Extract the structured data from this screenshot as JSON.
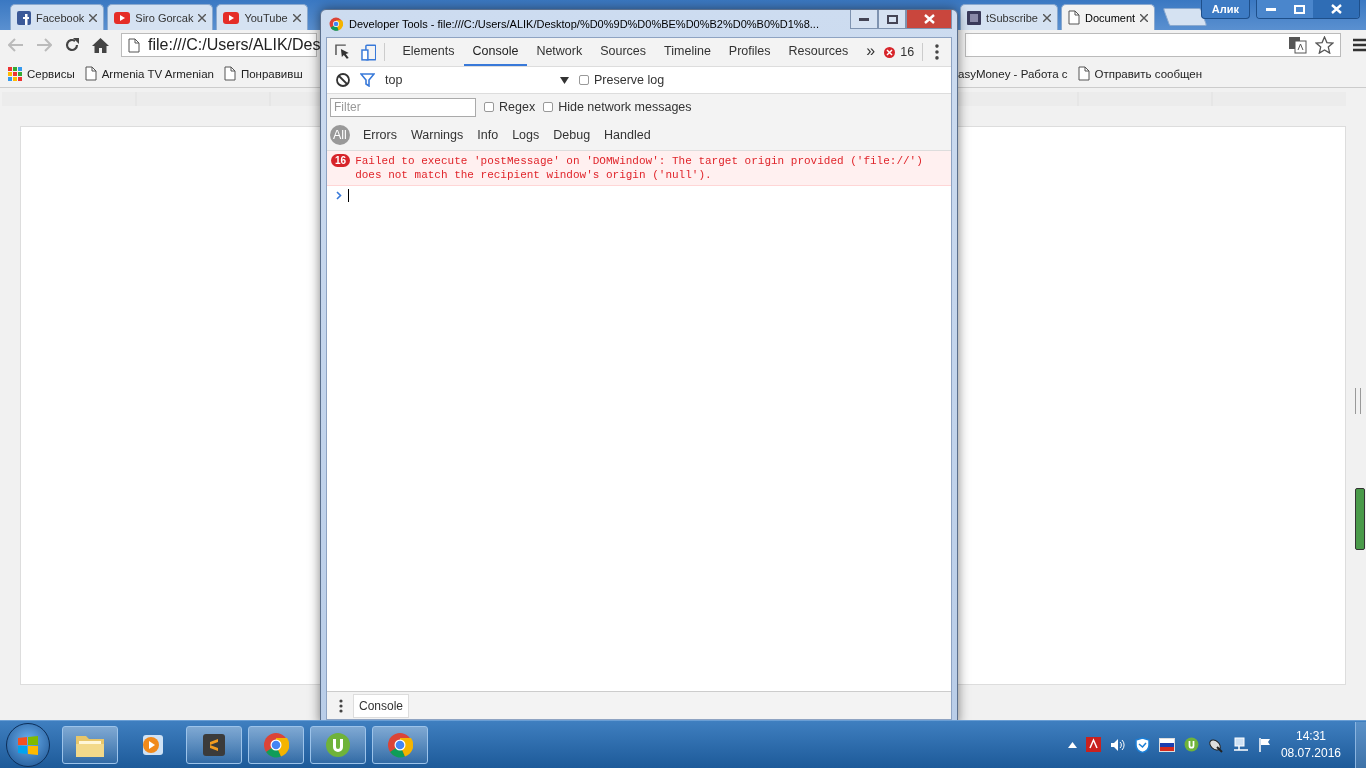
{
  "browser": {
    "tabs": [
      {
        "label": "Facebook",
        "kind": "square",
        "selected": false
      },
      {
        "label": "Siro Gorcak",
        "kind": "video",
        "selected": false
      },
      {
        "label": "YouTube",
        "kind": "video",
        "selected": false
      },
      {
        "label": "tSubscribe",
        "kind": "app",
        "selected": false
      },
      {
        "label": "Document",
        "kind": "page",
        "selected": true
      }
    ],
    "profile": "Алик",
    "address": "file:///C:/Users/ALIK/Des",
    "bookmarks": [
      {
        "label": "Сервисы",
        "kind": "apps"
      },
      {
        "label": "Armenia TV Armenian",
        "kind": "page"
      },
      {
        "label": "Понравивш",
        "kind": "page"
      },
      {
        "label": "asyMoney - Работа с",
        "kind": "none"
      },
      {
        "label": "Отправить сообщен",
        "kind": "page"
      }
    ]
  },
  "devtools": {
    "title": "Developer Tools - file:///C:/Users/ALIK/Desktop/%D0%9D%D0%BE%D0%B2%D0%B0%D1%8...",
    "tabs": [
      {
        "label": "Elements",
        "selected": false
      },
      {
        "label": "Console",
        "selected": true
      },
      {
        "label": "Network",
        "selected": false
      },
      {
        "label": "Sources",
        "selected": false
      },
      {
        "label": "Timeline",
        "selected": false
      },
      {
        "label": "Profiles",
        "selected": false
      },
      {
        "label": "Resources",
        "selected": false
      }
    ],
    "more": "»",
    "error_count": "16",
    "context": "top",
    "preserve_log": {
      "label": "Preserve log",
      "checked": false
    },
    "filter": {
      "placeholder": "Filter"
    },
    "options": [
      {
        "label": "Regex",
        "checked": false
      },
      {
        "label": "Hide network messages",
        "checked": false
      }
    ],
    "levels": [
      {
        "label": "All",
        "selected": true
      },
      {
        "label": "Errors",
        "selected": false
      },
      {
        "label": "Warnings",
        "selected": false
      },
      {
        "label": "Info",
        "selected": false
      },
      {
        "label": "Logs",
        "selected": false
      },
      {
        "label": "Debug",
        "selected": false
      },
      {
        "label": "Handled",
        "selected": false
      }
    ],
    "messages": [
      {
        "kind": "error",
        "count": "16",
        "text": "Failed to execute 'postMessage' on 'DOMWindow': The target origin provided ('file://') does not match the recipient window's origin ('null')."
      }
    ],
    "drawer_tabs": [
      {
        "label": "Console"
      }
    ]
  },
  "taskbar": {
    "apps": [
      {
        "kind": "folder",
        "running": true
      },
      {
        "kind": "player",
        "running": false
      },
      {
        "kind": "editor",
        "running": true
      },
      {
        "kind": "browser",
        "running": true
      },
      {
        "kind": "torrent",
        "running": true
      },
      {
        "kind": "browser",
        "running": true
      }
    ],
    "tray": [
      {
        "kind": "arrow"
      },
      {
        "kind": "pdf"
      },
      {
        "kind": "volume"
      },
      {
        "kind": "shield"
      },
      {
        "kind": "language"
      },
      {
        "kind": "torrent"
      },
      {
        "kind": "satellite"
      },
      {
        "kind": "network"
      },
      {
        "kind": "flag"
      }
    ],
    "time": "14:31",
    "date": "08.07.2016"
  }
}
